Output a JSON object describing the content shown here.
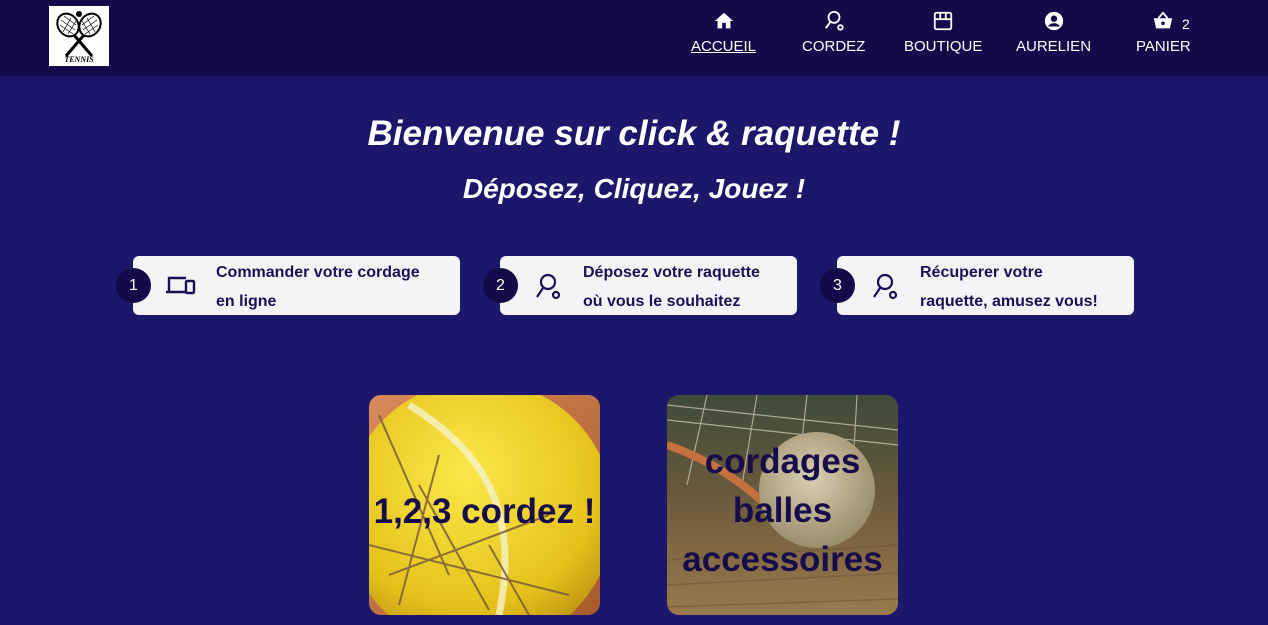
{
  "nav": {
    "logo_text": "TENNIS",
    "items": [
      {
        "label": "ACCUEIL",
        "icon": "home-icon"
      },
      {
        "label": "CORDEZ",
        "icon": "racket-icon"
      },
      {
        "label": "BOUTIQUE",
        "icon": "store-icon"
      },
      {
        "label": "AURELIEN",
        "icon": "account-icon"
      },
      {
        "label": "PANIER",
        "icon": "basket-icon",
        "count": "2"
      }
    ]
  },
  "hero": {
    "title": "Bienvenue sur click & raquette !",
    "subtitle": "Déposez, Cliquez, Jouez !"
  },
  "steps": [
    {
      "number": "1",
      "line1": "Commander votre cordage",
      "line2": "en ligne",
      "icon": "devices-icon"
    },
    {
      "number": "2",
      "line1": "Déposez votre raquette",
      "line2": "où vous le souhaitez",
      "icon": "racket-icon"
    },
    {
      "number": "3",
      "line1": "Récuperer votre",
      "line2": "raquette, amusez vous!",
      "icon": "racket-icon"
    }
  ],
  "cards": [
    {
      "lines": [
        "1,2,3 cordez !"
      ],
      "image": "tennis-ball-strings"
    },
    {
      "lines": [
        "cordages",
        "balles",
        "accessoires"
      ],
      "image": "old-tennis-ball-racket"
    }
  ],
  "colors": {
    "navbar": "#130a4a",
    "background": "#1c176b",
    "step_card": "#f4f4f6",
    "accent_text": "#1a1055"
  }
}
